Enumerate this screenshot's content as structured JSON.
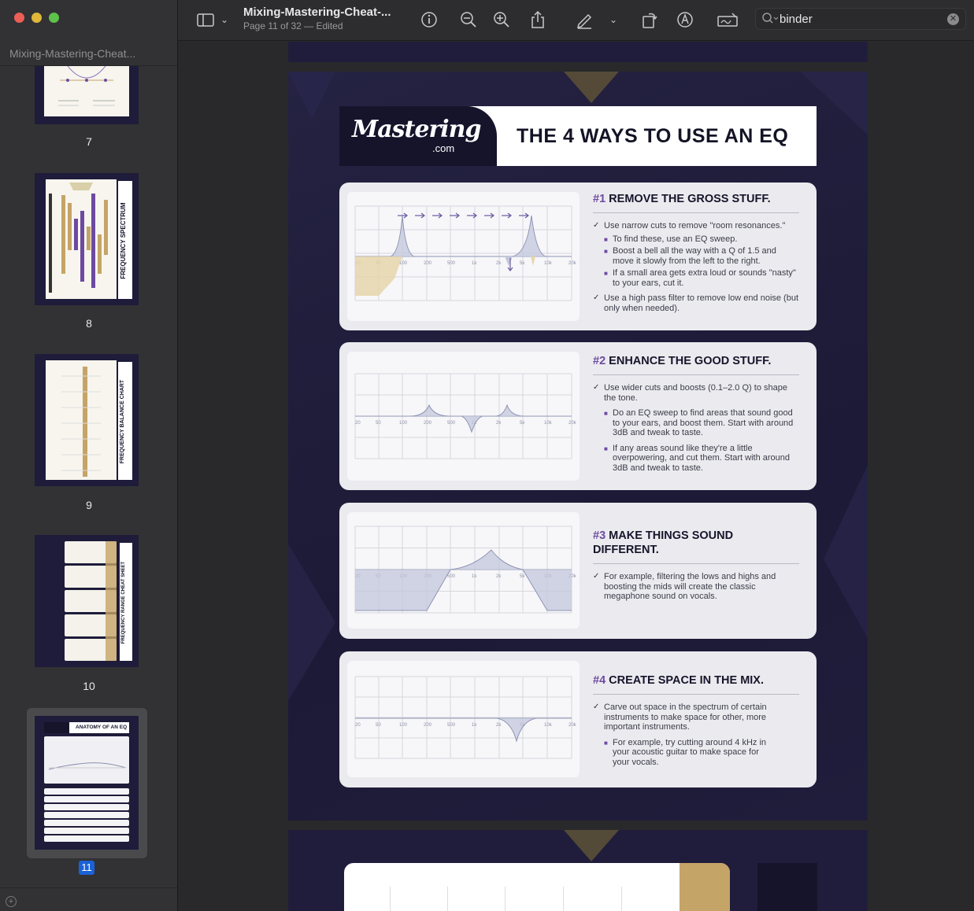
{
  "window": {
    "document_title": "Mixing-Mastering-Cheat-...",
    "page_status": "Page 11 of 32 — Edited"
  },
  "sidebar": {
    "title": "Mixing-Mastering-Cheat...",
    "pages": [
      {
        "label": "7"
      },
      {
        "label": "8",
        "thumb_text": "FREQUENCY SPECTRUM"
      },
      {
        "label": "9",
        "thumb_text": "FREQUENCY BALANCE CHART"
      },
      {
        "label": "10",
        "thumb_text": "FREQUENCY RANGE CHEAT SHEET"
      },
      {
        "label": "11",
        "thumb_text": "ANATOMY OF AN EQ",
        "selected": true
      }
    ]
  },
  "toolbar": {
    "icons": [
      "sidebar-icon",
      "chevron-down-icon",
      "info-icon",
      "zoom-out-icon",
      "zoom-in-icon",
      "share-icon",
      "markup-pen-icon",
      "chevron-down-icon",
      "rotate-icon",
      "annotate-icon",
      "signature-icon"
    ]
  },
  "search": {
    "value": "binder"
  },
  "page": {
    "logo": "Mastering",
    "logo_suffix": ".com",
    "title": "THE 4 WAYS TO USE AN EQ",
    "freq_ticks": [
      "20",
      "50",
      "100",
      "200",
      "500",
      "1k",
      "2k",
      "5k",
      "10k",
      "20k"
    ],
    "cards": [
      {
        "num": "#1",
        "title": "REMOVE THE GROSS STUFF.",
        "bullets": [
          {
            "text": "Use narrow cuts to remove \"room resonances.\"",
            "subs": [
              "To find these, use an EQ sweep.",
              "Boost a bell all the way with a Q of 1.5 and move it slowly from the left to the right.",
              "If a small area gets extra loud or sounds \"nasty\" to your ears, cut it."
            ]
          },
          {
            "text": "Use a high pass filter to remove low end noise (but only when needed).",
            "subs": []
          }
        ]
      },
      {
        "num": "#2",
        "title": "ENHANCE THE GOOD STUFF.",
        "bullets": [
          {
            "text": "Use wider cuts and boosts (0.1–2.0 Q) to shape the tone.",
            "subs": [
              "Do an EQ sweep to find areas that sound good to your ears, and boost them. Start with around 3dB and tweak to taste.",
              "If any areas sound like they're a little overpowering, and cut them. Start with around 3dB and tweak to taste."
            ]
          }
        ]
      },
      {
        "num": "#3",
        "title": "MAKE THINGS SOUND DIFFERENT.",
        "bullets": [
          {
            "text": "For example, filtering the lows and highs and boosting the mids will create the classic megaphone sound on vocals.",
            "subs": []
          }
        ]
      },
      {
        "num": "#4",
        "title": "CREATE SPACE IN THE MIX.",
        "bullets": [
          {
            "text": "Carve out space in the spectrum of certain instruments to make space for other, more important instruments.",
            "subs": [
              "For example, try cutting around 4 kHz in your acoustic guitar to make space for your vocals."
            ]
          }
        ]
      }
    ]
  },
  "colors": {
    "page_bg": "#201d3c",
    "card_bg": "#ebebef",
    "accent_purple": "#6d4aa0",
    "accent_gold": "#c5a467",
    "curve_fill": "#c3c7db"
  }
}
